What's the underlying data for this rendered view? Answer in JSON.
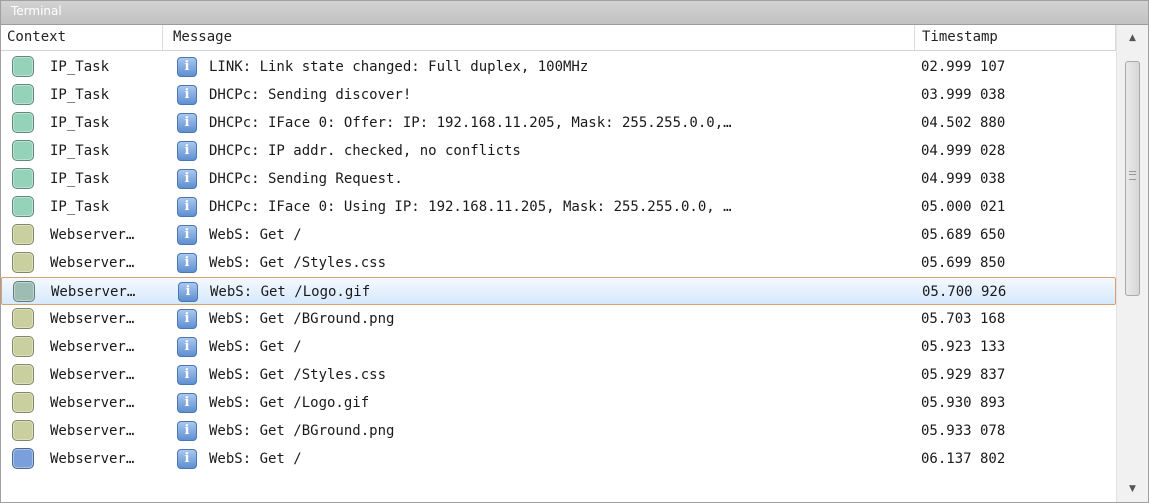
{
  "window": {
    "title": "Terminal"
  },
  "columns": {
    "context": "Context",
    "message": "Message",
    "timestamp": "Timestamp"
  },
  "colors": {
    "ip_task": "#94d3b9",
    "webserver": "#c9cf9e",
    "webserver_selected": "#9dbdb3",
    "webserver_last": "#7aa0dc",
    "selection_border": "#d9a26a"
  },
  "icons": {
    "info": "info-icon",
    "scroll_up": "scroll-up-arrow",
    "scroll_down": "scroll-down-arrow"
  },
  "rows": [
    {
      "context": "IP_Task",
      "message": "LINK: Link state changed: Full duplex, 100MHz",
      "timestamp": "02.999 107",
      "color": "#94d3b9",
      "selected": false
    },
    {
      "context": "IP_Task",
      "message": "DHCPc: Sending discover!",
      "timestamp": "03.999 038",
      "color": "#94d3b9",
      "selected": false
    },
    {
      "context": "IP_Task",
      "message": "DHCPc: IFace 0: Offer: IP: 192.168.11.205, Mask: 255.255.0.0,…",
      "timestamp": "04.502 880",
      "color": "#94d3b9",
      "selected": false
    },
    {
      "context": "IP_Task",
      "message": "DHCPc: IP addr. checked, no conflicts",
      "timestamp": "04.999 028",
      "color": "#94d3b9",
      "selected": false
    },
    {
      "context": "IP_Task",
      "message": "DHCPc: Sending Request.",
      "timestamp": "04.999 038",
      "color": "#94d3b9",
      "selected": false
    },
    {
      "context": "IP_Task",
      "message": "DHCPc: IFace 0: Using IP: 192.168.11.205, Mask: 255.255.0.0, …",
      "timestamp": "05.000 021",
      "color": "#94d3b9",
      "selected": false
    },
    {
      "context": "Webserver…",
      "message": "WebS: Get /",
      "timestamp": "05.689 650",
      "color": "#c9cf9e",
      "selected": false
    },
    {
      "context": "Webserver…",
      "message": "WebS: Get /Styles.css",
      "timestamp": "05.699 850",
      "color": "#c9cf9e",
      "selected": false
    },
    {
      "context": "Webserver…",
      "message": "WebS: Get /Logo.gif",
      "timestamp": "05.700 926",
      "color": "#9dbdb3",
      "selected": true
    },
    {
      "context": "Webserver…",
      "message": "WebS: Get /BGround.png",
      "timestamp": "05.703 168",
      "color": "#c9cf9e",
      "selected": false
    },
    {
      "context": "Webserver…",
      "message": "WebS: Get /",
      "timestamp": "05.923 133",
      "color": "#c9cf9e",
      "selected": false
    },
    {
      "context": "Webserver…",
      "message": "WebS: Get /Styles.css",
      "timestamp": "05.929 837",
      "color": "#c9cf9e",
      "selected": false
    },
    {
      "context": "Webserver…",
      "message": "WebS: Get /Logo.gif",
      "timestamp": "05.930 893",
      "color": "#c9cf9e",
      "selected": false
    },
    {
      "context": "Webserver…",
      "message": "WebS: Get /BGround.png",
      "timestamp": "05.933 078",
      "color": "#c9cf9e",
      "selected": false
    },
    {
      "context": "Webserver…",
      "message": "WebS: Get /",
      "timestamp": "06.137 802",
      "color": "#7aa0dc",
      "selected": false
    }
  ]
}
